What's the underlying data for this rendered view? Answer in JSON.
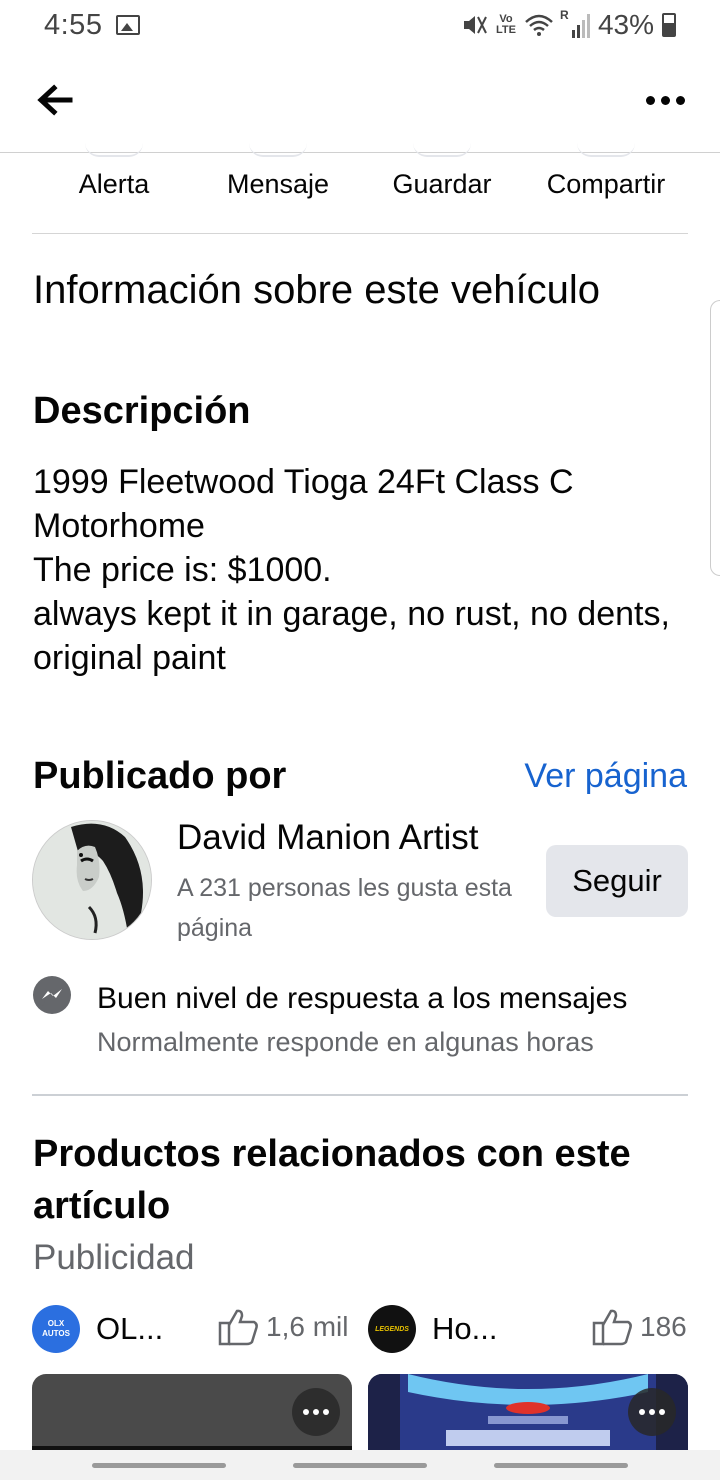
{
  "status_bar": {
    "time": "4:55",
    "network_top": "Vo",
    "network_bottom": "LTE",
    "roaming": "R",
    "battery": "43%"
  },
  "actions": [
    {
      "label": "Alerta"
    },
    {
      "label": "Mensaje"
    },
    {
      "label": "Guardar"
    },
    {
      "label": "Compartir"
    }
  ],
  "info_title": "Información sobre este vehículo",
  "description": {
    "heading": "Descripción",
    "lines": [
      "1999 Fleetwood Tioga 24Ft Class C Motorhome",
      "The price is: $1000.",
      "always kept it in garage, no rust, no dents, original paint"
    ]
  },
  "seller": {
    "heading": "Publicado por",
    "view_page": "Ver página",
    "name": "David Manion Artist",
    "likes": "A 231 personas les gusta esta página",
    "follow": "Seguir",
    "response_title": "Buen nivel de respuesta a los mensajes",
    "response_sub": "Normalmente responde en algunas horas"
  },
  "related": {
    "title": "Productos relacionados con este artículo",
    "subtitle": "Publicidad",
    "ads": [
      {
        "name": "OL...",
        "likes": "1,6 mil",
        "logo_text": "OLX AUTOS",
        "logo_color": "#2b6fe0"
      },
      {
        "name": "Ho...",
        "likes": "186",
        "logo_text": "LEGENDS",
        "logo_color": "#111111"
      }
    ]
  },
  "colors": {
    "link": "#1763cf",
    "secondary_text": "#65676b",
    "button_bg": "#e4e6eb"
  }
}
